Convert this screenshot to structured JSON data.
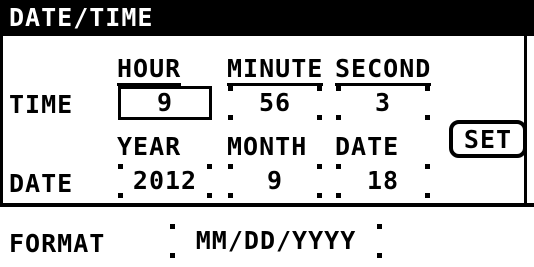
{
  "title": "DATE/TIME",
  "time_row": {
    "label": "TIME",
    "hour": {
      "header": "HOUR",
      "value": "9"
    },
    "minute": {
      "header": "MINUTE",
      "value": "56"
    },
    "second": {
      "header": "SECOND",
      "value": "3"
    }
  },
  "date_row": {
    "label": "DATE",
    "year": {
      "header": "YEAR",
      "value": "2012"
    },
    "month": {
      "header": "MONTH",
      "value": "9"
    },
    "date": {
      "header": "DATE",
      "value": "18"
    }
  },
  "set_button": "SET",
  "format": {
    "label": "FORMAT",
    "value": "MM/DD/YYYY"
  }
}
